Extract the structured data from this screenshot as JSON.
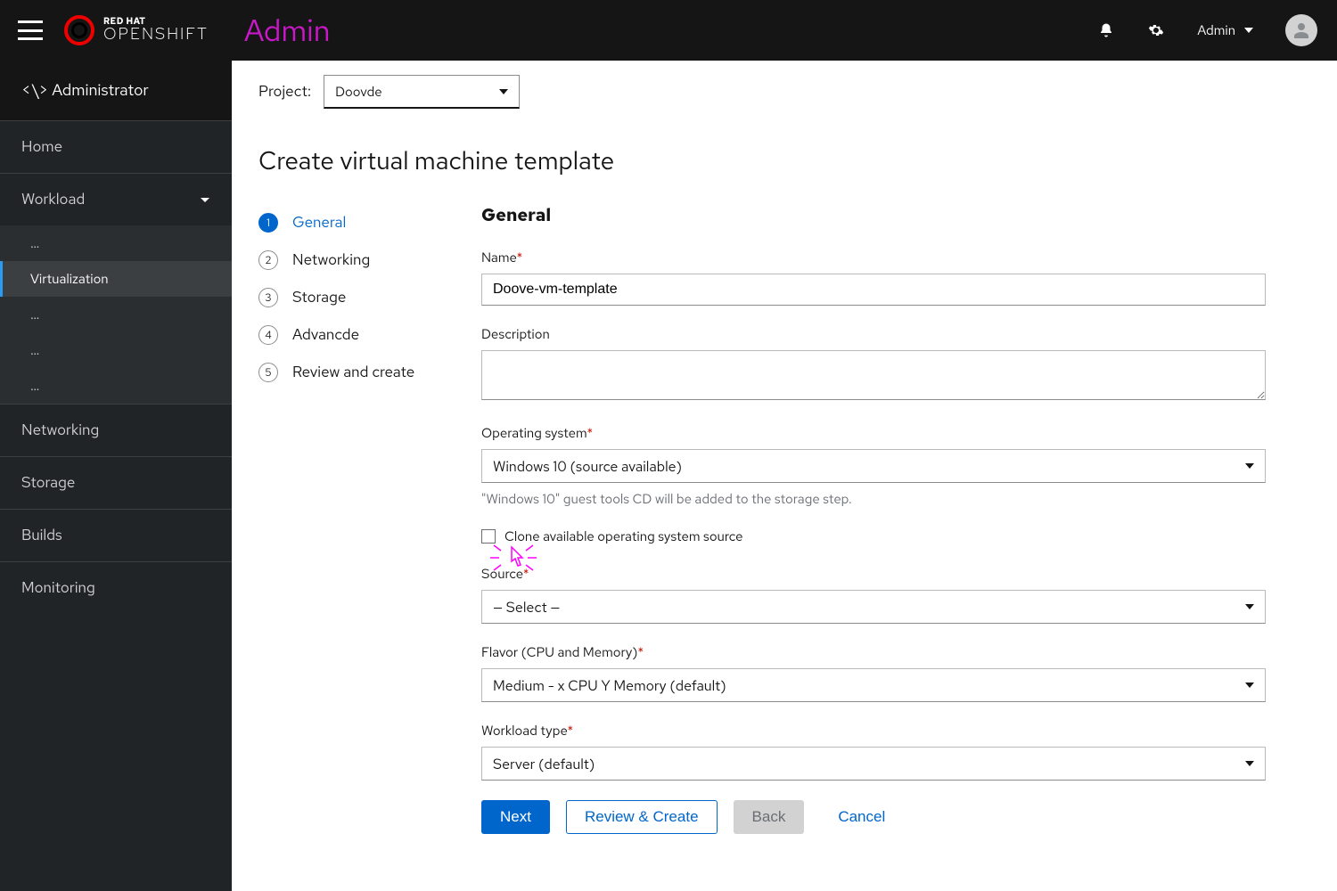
{
  "header": {
    "brand_top": "RED HAT",
    "brand_bottom": "OPENSHIFT",
    "title": "Admin",
    "user_menu_label": "Admin"
  },
  "sidebar": {
    "perspective": "<\\> Administrator",
    "items": [
      {
        "label": "Home"
      },
      {
        "label": "Workload",
        "expanded": true,
        "children": [
          {
            "label": "…"
          },
          {
            "label": "Virtualization",
            "active": true
          },
          {
            "label": "…"
          },
          {
            "label": "…"
          },
          {
            "label": "…"
          }
        ]
      },
      {
        "label": "Networking"
      },
      {
        "label": "Storage"
      },
      {
        "label": "Builds"
      },
      {
        "label": "Monitoring"
      }
    ]
  },
  "project_bar": {
    "label": "Project:",
    "selected": "Doovde"
  },
  "page": {
    "title": "Create virtual machine template"
  },
  "wizard": {
    "steps": [
      {
        "num": "1",
        "label": "General",
        "active": true
      },
      {
        "num": "2",
        "label": "Networking"
      },
      {
        "num": "3",
        "label": "Storage"
      },
      {
        "num": "4",
        "label": "Advancde"
      },
      {
        "num": "5",
        "label": "Review and create"
      }
    ]
  },
  "form": {
    "heading": "General",
    "name_label": "Name",
    "name_value": "Doove-vm-template",
    "description_label": "Description",
    "description_value": "",
    "os_label": "Operating system",
    "os_value": "Windows 10 (source available)",
    "os_helper": "\"Windows 10\" guest tools CD will be added to the storage step.",
    "clone_label": "Clone available operating system source",
    "source_label": "Source",
    "source_value": "— Select —",
    "flavor_label": "Flavor (CPU and Memory)",
    "flavor_value": "Medium - x CPU Y Memory (default)",
    "workload_label": "Workload type",
    "workload_value": "Server (default)"
  },
  "actions": {
    "next": "Next",
    "review": "Review & Create",
    "back": "Back",
    "cancel": "Cancel"
  }
}
